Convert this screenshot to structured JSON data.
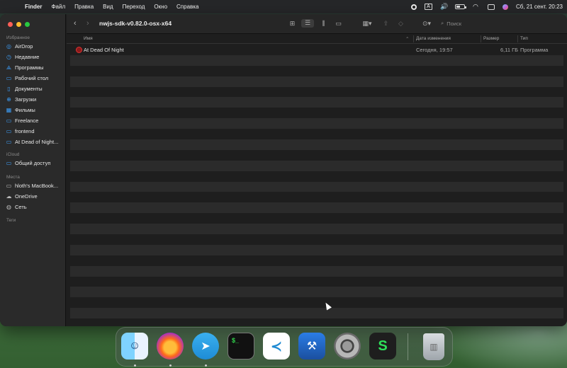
{
  "menubar": {
    "app_name": "Finder",
    "menus": [
      "Файл",
      "Правка",
      "Вид",
      "Переход",
      "Окно",
      "Справка"
    ],
    "status_icons": [
      "record-icon",
      "input-source-icon",
      "volume-icon",
      "battery-icon",
      "wifi-icon",
      "control-center-icon",
      "siri-icon"
    ],
    "input_source": "A",
    "clock": "Сб, 21 сент.  20:23"
  },
  "window": {
    "title": "nwjs-sdk-v0.82.0-osx-x64",
    "search_placeholder": "Поиск"
  },
  "sidebar": {
    "sections": {
      "favorites": "Избранное",
      "icloud": "iCloud",
      "locations": "Места",
      "tags": "Теги"
    },
    "favorites": [
      {
        "label": "AirDrop",
        "icon": "airdrop-icon"
      },
      {
        "label": "Недавние",
        "icon": "clock-icon"
      },
      {
        "label": "Программы",
        "icon": "applications-icon"
      },
      {
        "label": "Рабочий стол",
        "icon": "desktop-icon"
      },
      {
        "label": "Документы",
        "icon": "document-icon"
      },
      {
        "label": "Загрузки",
        "icon": "download-icon"
      },
      {
        "label": "Фильмы",
        "icon": "film-icon"
      },
      {
        "label": "Freelance",
        "icon": "folder-icon"
      },
      {
        "label": "frontend",
        "icon": "folder-icon"
      },
      {
        "label": "At Dead of Night...",
        "icon": "folder-icon"
      }
    ],
    "icloud": [
      {
        "label": "Общий доступ",
        "icon": "shared-folder-icon"
      }
    ],
    "locations": [
      {
        "label": "hloth's MacBook...",
        "icon": "laptop-icon"
      },
      {
        "label": "OneDrive",
        "icon": "cloud-icon"
      },
      {
        "label": "Сеть",
        "icon": "network-icon"
      }
    ]
  },
  "columns": {
    "name": "Имя",
    "date": "Дата изменения",
    "size": "Размер",
    "kind": "Тип"
  },
  "files": [
    {
      "name": "At Dead Of Night",
      "date": "Сегодня, 19:57",
      "size": "6,11 ГБ",
      "kind": "Программа"
    }
  ],
  "dock": {
    "apps": [
      "Finder",
      "Firefox",
      "Telegram",
      "Terminal",
      "Visual Studio Code",
      "Xcode",
      "System Settings",
      "Sublime Text",
      "Trash"
    ],
    "terminal_glyph": "$_"
  }
}
